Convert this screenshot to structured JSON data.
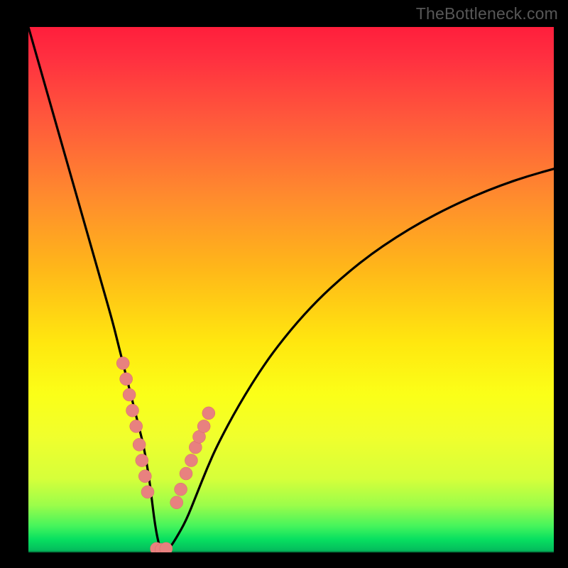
{
  "watermark": "TheBottleneck.com",
  "chart_data": {
    "type": "line",
    "title": "",
    "xlabel": "",
    "ylabel": "",
    "ylim": [
      0,
      100
    ],
    "xlim": [
      0,
      100
    ],
    "x": [
      0,
      2,
      4,
      6,
      8,
      10,
      12,
      14,
      16,
      17,
      18,
      19,
      20,
      21,
      22,
      23,
      23.5,
      24,
      24.5,
      25,
      25.5,
      26,
      27,
      28,
      30,
      32,
      34,
      36,
      40,
      45,
      50,
      55,
      60,
      65,
      70,
      75,
      80,
      85,
      90,
      95,
      100
    ],
    "y": [
      100,
      93,
      86,
      79,
      72,
      65,
      58,
      51,
      44,
      40,
      36,
      32,
      28,
      24,
      20,
      14,
      10,
      6,
      3,
      1,
      0.5,
      0.5,
      1,
      2.5,
      6,
      11,
      16,
      20.5,
      28,
      36,
      42.5,
      48,
      52.6,
      56.6,
      60,
      63,
      65.6,
      67.9,
      69.9,
      71.6,
      73
    ],
    "highlight_points_left": {
      "x": [
        18.0,
        18.6,
        19.2,
        19.8,
        20.5,
        21.1,
        21.6,
        22.2,
        22.7
      ],
      "y": [
        36,
        33,
        30,
        27,
        24,
        20.5,
        17.5,
        14.5,
        11.5
      ]
    },
    "highlight_points_right": {
      "x": [
        28.2,
        29.0,
        30.0,
        31.0,
        31.8,
        32.5,
        33.4,
        34.3
      ],
      "y": [
        9.5,
        12,
        15,
        17.5,
        20,
        22,
        24,
        26.5
      ]
    },
    "highlight_points_bottom": {
      "x": [
        24.4,
        25.3,
        26.2
      ],
      "y": [
        0.7,
        0.5,
        0.7
      ]
    },
    "gradient_stops": [
      {
        "pct": 0,
        "color": "#ff1e3c"
      },
      {
        "pct": 60,
        "color": "#ffe70f"
      },
      {
        "pct": 95,
        "color": "#45f45c"
      },
      {
        "pct": 100,
        "color": "#04b45a"
      }
    ]
  }
}
